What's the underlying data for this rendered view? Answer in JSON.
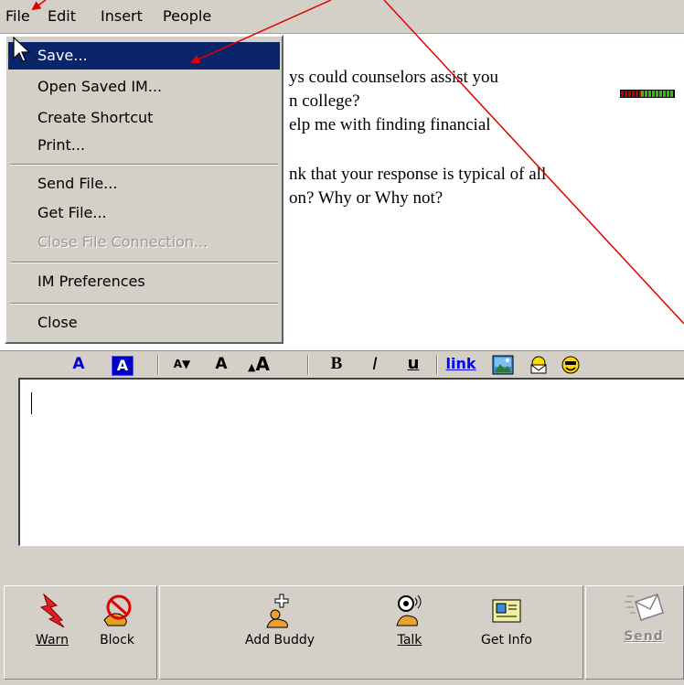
{
  "menubar": {
    "items": [
      "File",
      "Edit",
      "Insert",
      "People"
    ]
  },
  "conversation": {
    "lines": [
      "ys could counselors assist you",
      "n college?",
      "elp me with finding financial",
      "nk that your response is typical of all",
      "on? Why or Why not?"
    ]
  },
  "file_menu": {
    "items": [
      {
        "label": "Save...",
        "state": "selected"
      },
      {
        "label": "Open Saved IM...",
        "state": "normal"
      },
      {
        "label": "Create Shortcut",
        "state": "normal"
      },
      {
        "label": "Print...",
        "state": "normal"
      },
      {
        "label": "Send File...",
        "state": "normal"
      },
      {
        "label": "Get File...",
        "state": "normal"
      },
      {
        "label": "Close File Connection...",
        "state": "disabled"
      },
      {
        "label": "IM Preferences",
        "state": "normal"
      },
      {
        "label": "Close",
        "state": "normal"
      }
    ]
  },
  "format_toolbar": {
    "text_color": "A",
    "back_color": "A",
    "smaller": "A",
    "normal": "A",
    "larger": "A",
    "bold": "B",
    "italic": "I",
    "underline": "u",
    "link": "link"
  },
  "bottom_toolbar": {
    "warn": "Warn",
    "block": "Block",
    "add_buddy": "Add Buddy",
    "talk": "Talk",
    "get_info": "Get Info",
    "send": "Send"
  },
  "colors": {
    "annotation_arrow": "#e00000",
    "selected_bg": "#0a246a",
    "format_blue": "#0000d0",
    "link_blue": "#0000ff"
  }
}
